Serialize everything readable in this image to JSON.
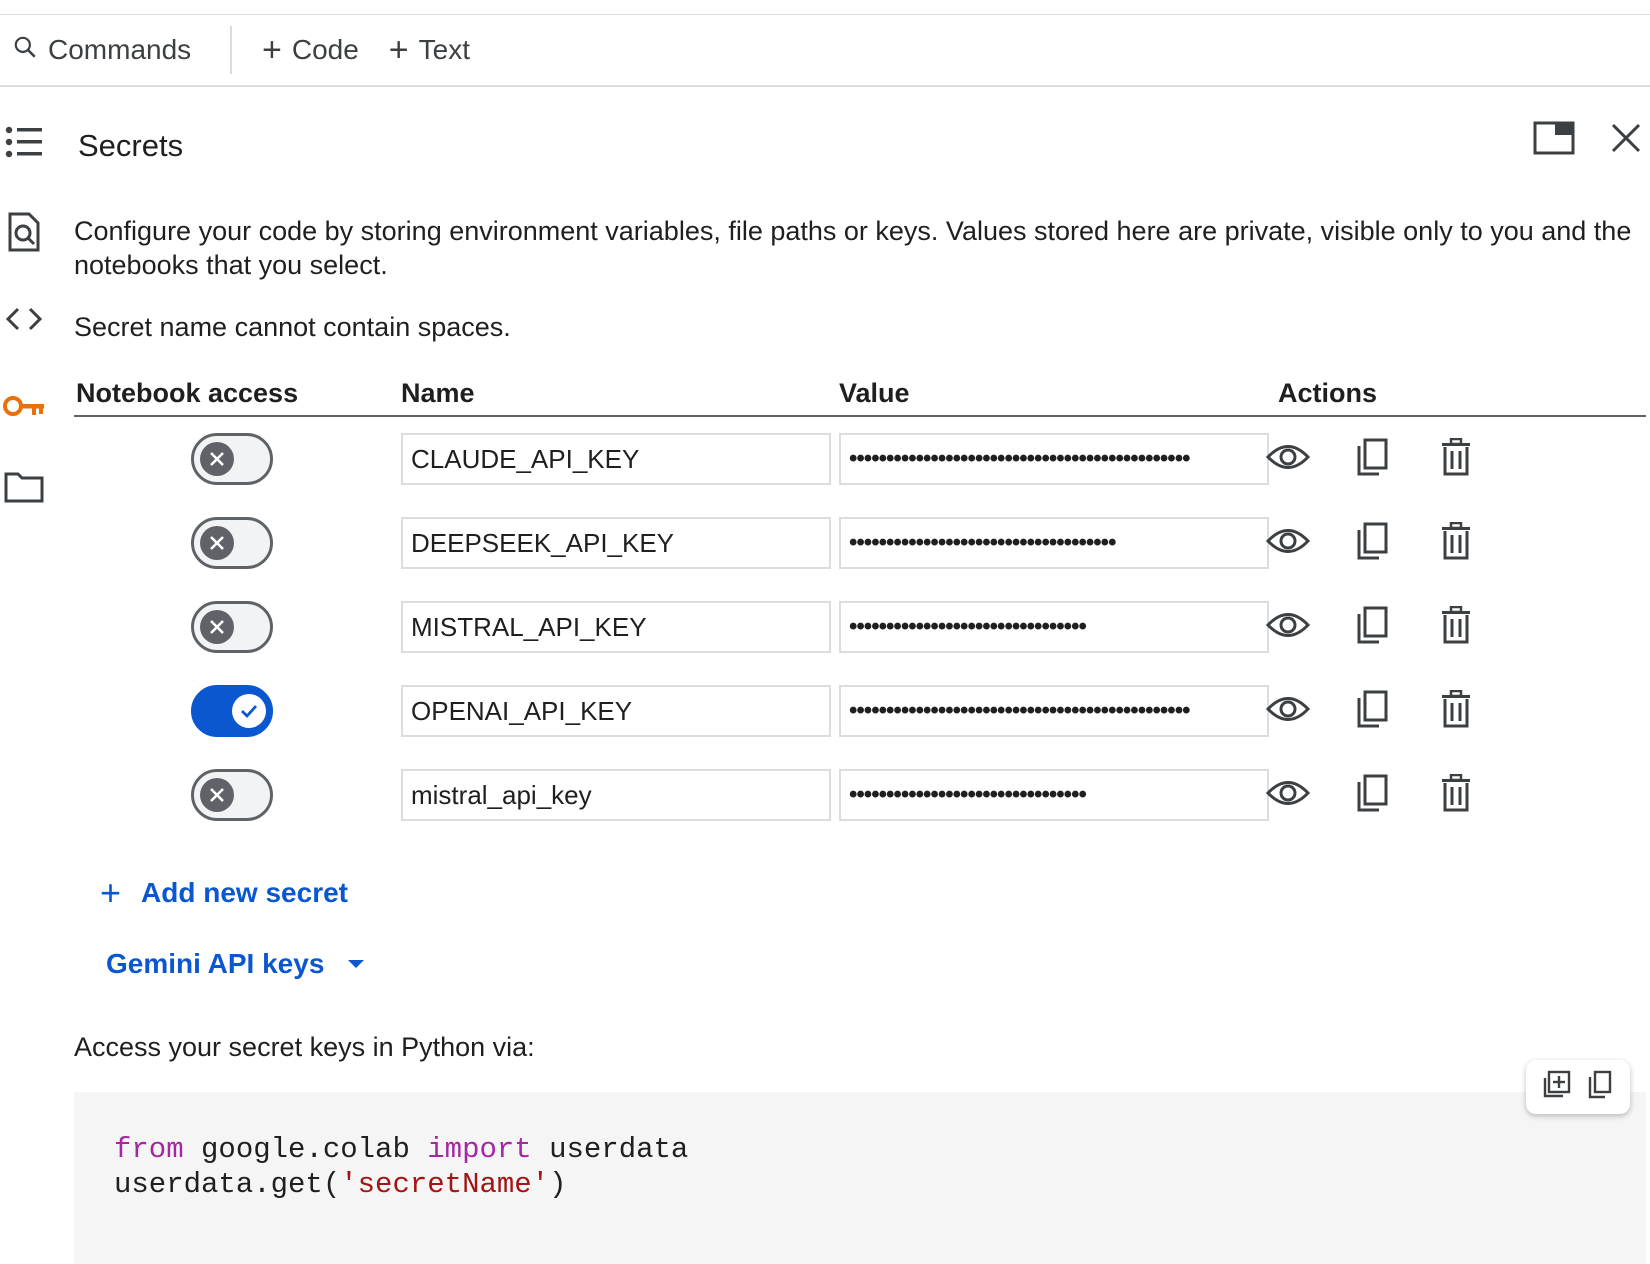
{
  "toolbar": {
    "commands_label": "Commands",
    "code_label": "Code",
    "text_label": "Text"
  },
  "panel": {
    "title": "Secrets",
    "description": "Configure your code by storing environment variables, file paths or keys. Values stored here are private, visible only to you and the notebooks that you select.",
    "note": "Secret name cannot contain spaces."
  },
  "table": {
    "headers": [
      "Notebook access",
      "Name",
      "Value",
      "Actions"
    ],
    "rows": [
      {
        "name": "CLAUDE_API_KEY",
        "value": "••••••••••••••••••••••••••••••••••••••••••••••",
        "access": false
      },
      {
        "name": "DEEPSEEK_API_KEY",
        "value": "••••••••••••••••••••••••••••••••••••",
        "access": false
      },
      {
        "name": "MISTRAL_API_KEY",
        "value": "••••••••••••••••••••••••••••••••",
        "access": false
      },
      {
        "name": "OPENAI_API_KEY",
        "value": "••••••••••••••••••••••••••••••••••••••••••••••",
        "access": true
      },
      {
        "name": "mistral_api_key",
        "value": "••••••••••••••••••••••••••••••••",
        "access": false
      }
    ]
  },
  "add_secret_label": "Add new secret",
  "gemini_label": "Gemini API keys",
  "access_label": "Access your secret keys in Python via:",
  "code": {
    "line1": {
      "kw1": "from",
      "mod": " google.colab ",
      "kw2": "import",
      "rest": " userdata"
    },
    "line2": {
      "pre": "userdata.get(",
      "str": "'secretName'",
      "post": ")"
    }
  },
  "colors": {
    "accent": "#0b57d0",
    "key_icon": "#e8710a",
    "keyword": "#a626a4",
    "string": "#a31515"
  }
}
